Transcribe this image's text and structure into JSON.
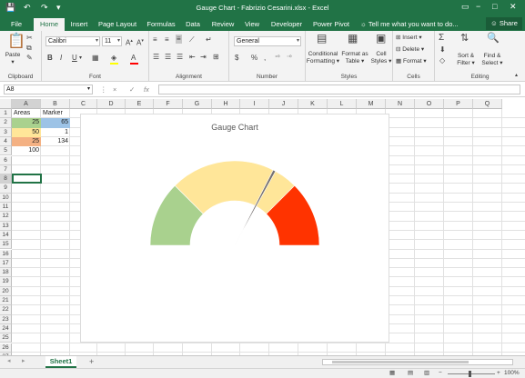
{
  "titlebar": {
    "title": "Gauge Chart - Fabrizio Cesarini.xlsx - Excel",
    "save_icon": "save-icon",
    "undo_icon": "undo-icon",
    "redo_icon": "redo-icon",
    "customize_icon": "customize-icon",
    "window_icons": [
      "ribbon-display-icon",
      "minimize-icon",
      "maximize-icon",
      "close-icon"
    ]
  },
  "tabs": [
    {
      "label": "File"
    },
    {
      "label": "Home"
    },
    {
      "label": "Insert"
    },
    {
      "label": "Page Layout"
    },
    {
      "label": "Formulas"
    },
    {
      "label": "Data"
    },
    {
      "label": "Review"
    },
    {
      "label": "View"
    },
    {
      "label": "Developer"
    },
    {
      "label": "Power Pivot"
    }
  ],
  "tellme": "Tell me what you want to do...",
  "share": "Share",
  "ribbon": {
    "clipboard": {
      "label": "Clipboard",
      "paste": "Paste"
    },
    "font": {
      "label": "Font",
      "name": "Calibri",
      "size": "11",
      "bold": "B",
      "italic": "I",
      "underline": "U"
    },
    "alignment": {
      "label": "Alignment"
    },
    "number": {
      "label": "Number",
      "format": "General",
      "currency": "$",
      "percent": "%",
      "comma": ","
    },
    "styles": {
      "label": "Styles",
      "conditional": "Conditional",
      "conditional2": "Formatting",
      "formatas": "Format as",
      "formatas2": "Table",
      "cell": "Cell",
      "cell2": "Styles"
    },
    "cells": {
      "label": "Cells",
      "insert": "Insert",
      "delete": "Delete",
      "format": "Format"
    },
    "editing": {
      "label": "Editing",
      "sort": "Sort &",
      "sort2": "Filter",
      "find": "Find &",
      "find2": "Select"
    }
  },
  "formula": {
    "namebox": "A8",
    "cancel": "×",
    "enter": "✓",
    "fx": "fx",
    "value": ""
  },
  "columns": [
    "A",
    "B",
    "C",
    "D",
    "E",
    "F",
    "G",
    "H",
    "I",
    "J",
    "K",
    "L",
    "M",
    "N",
    "O",
    "P",
    "Q"
  ],
  "rows": [
    "1",
    "2",
    "3",
    "4",
    "5",
    "6",
    "7",
    "8",
    "9",
    "10",
    "11",
    "12",
    "13",
    "14",
    "15",
    "16",
    "17",
    "18",
    "19",
    "20",
    "21",
    "22",
    "23",
    "24",
    "25",
    "26",
    "27"
  ],
  "cells": {
    "A1": "Areas",
    "B1": "Marker",
    "A2": "25",
    "B2": "65",
    "A3": "50",
    "B3": "1",
    "A4": "25",
    "B4": "134",
    "A5": "100"
  },
  "colors": {
    "green": "#a9d18e",
    "yellow": "#ffe699",
    "red": "#ff3300",
    "blue": "#9dc3e6",
    "orange": "#f4b183",
    "needle": "#767171",
    "excel": "#217346"
  },
  "chart_data": {
    "type": "pie",
    "title": "Gauge Chart",
    "series": [
      {
        "values": [
          25,
          50,
          25,
          100
        ],
        "colors": [
          "#a9d18e",
          "#ffe699",
          "#ff3300",
          "none"
        ]
      },
      {
        "values": [
          65,
          1,
          134
        ],
        "colors": [
          "none",
          "#767171",
          "none"
        ]
      }
    ]
  },
  "sheet": {
    "name": "Sheet1",
    "add": "+"
  },
  "status": {
    "zoom": "100%",
    "minus": "−",
    "plus": "+"
  }
}
